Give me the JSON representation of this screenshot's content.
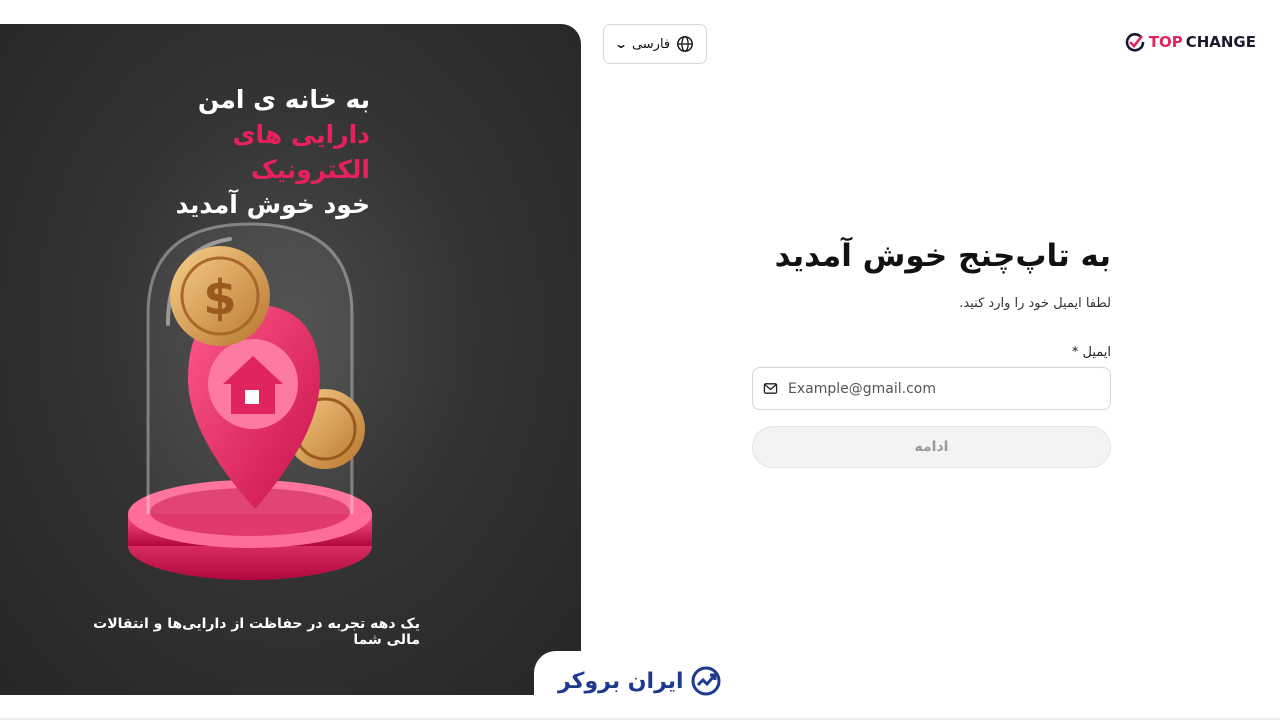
{
  "promo": {
    "headline": [
      "به خانه ی امن",
      "دارایی های الکترونیک",
      "خود خوش آمدید"
    ],
    "footer": "یک دهه تجربه در حفاظت از دارایی‌ها و انتقالات مالی شما",
    "accent_color": "#e8215e"
  },
  "brand_tab": {
    "text": "ایران بروکر",
    "icon": "chart-growth-icon"
  },
  "language": {
    "label": "فارسی",
    "icon": "globe-icon",
    "chevron": "chevron-down-icon"
  },
  "logo": {
    "top": "TOP",
    "change": "CHANGE",
    "icon": "check-circle-icon"
  },
  "form": {
    "title": "به تاپ‌چنج خوش آمدید",
    "subtitle": "لطفا ایمیل خود را وارد کنید.",
    "email_label": "ایمیل",
    "required_mark": "*",
    "email_placeholder": "Example@gmail.com",
    "email_value": "",
    "continue_label": "ادامه"
  }
}
